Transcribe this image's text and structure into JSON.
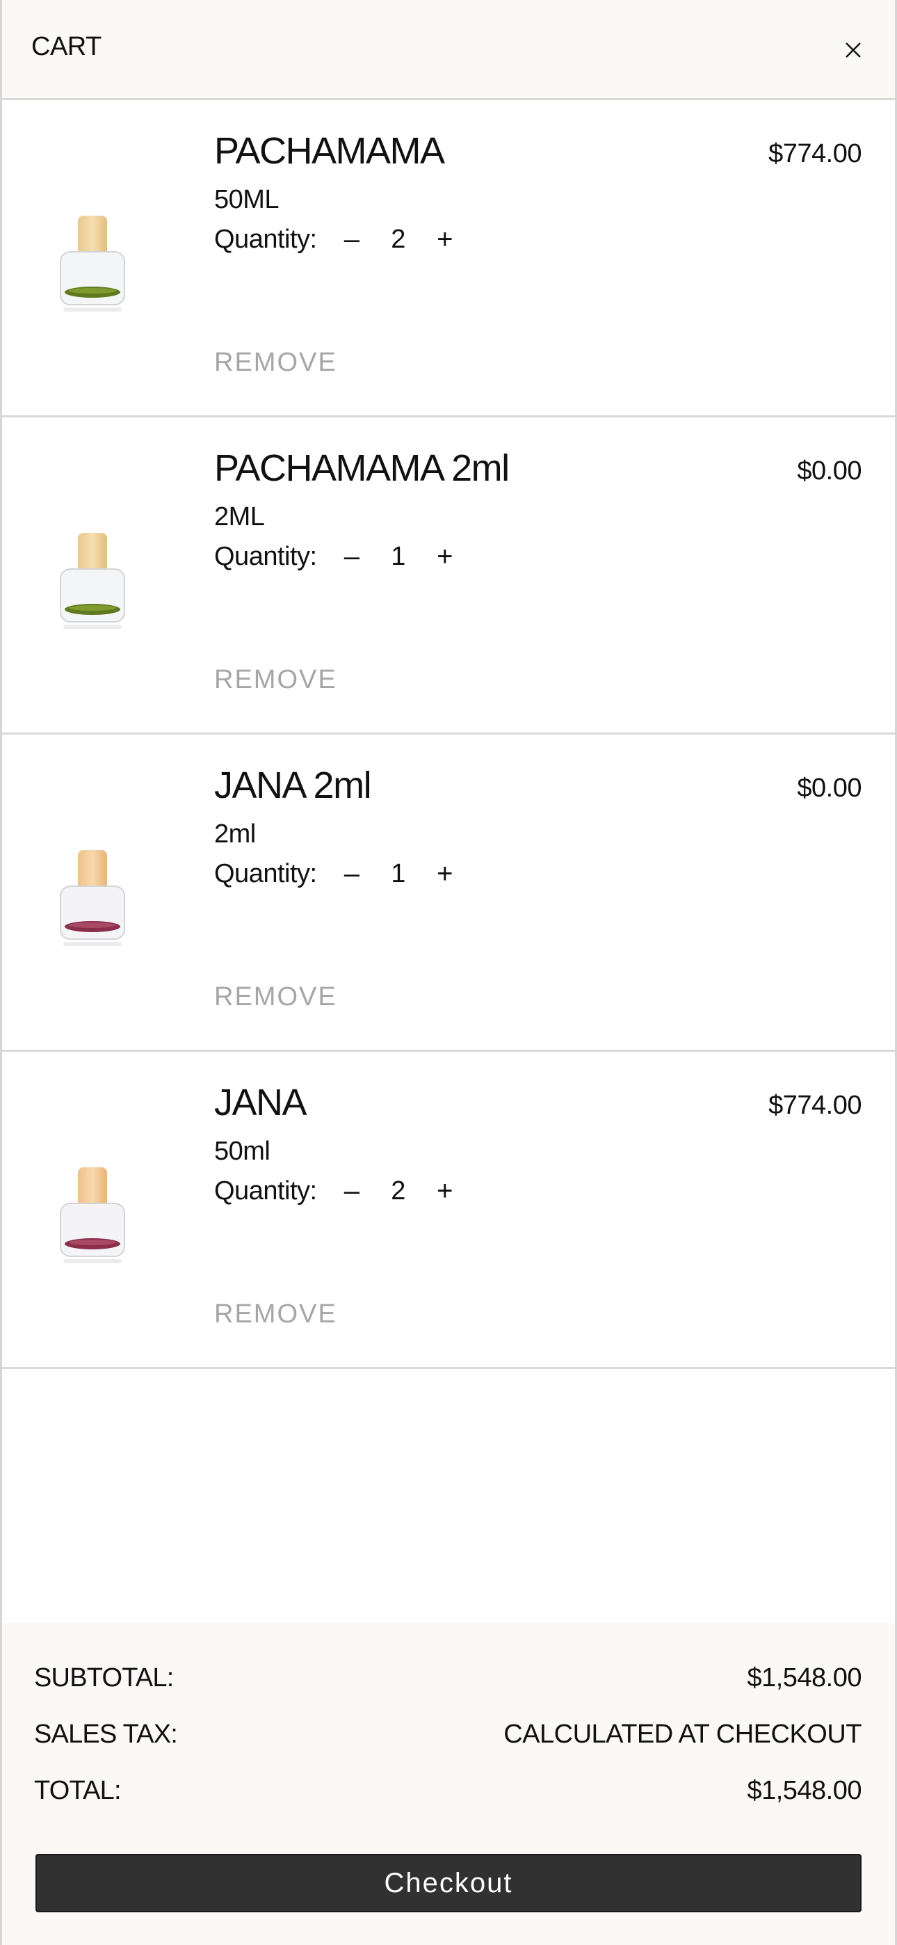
{
  "header": {
    "title": "CART",
    "close_icon": "close-icon"
  },
  "colors": {
    "header_bg": "#faf9f6",
    "remove_text": "#a6a6a6",
    "checkout_bg": "#313131",
    "divider": "#d9d9d9"
  },
  "quantity_label": "Quantity:",
  "decrement_label": "–",
  "increment_label": "+",
  "remove_label": "REMOVE",
  "items": [
    {
      "name": "PACHAMAMA",
      "price": "$774.00",
      "variant": "50ML",
      "quantity": "2",
      "image": "perfume-bottle-green-icon"
    },
    {
      "name": "PACHAMAMA 2ml",
      "price": "$0.00",
      "variant": "2ML",
      "quantity": "1",
      "image": "perfume-bottle-green-icon"
    },
    {
      "name": "JANA 2ml",
      "price": "$0.00",
      "variant": "2ml",
      "quantity": "1",
      "image": "perfume-bottle-red-icon"
    },
    {
      "name": "JANA",
      "price": "$774.00",
      "variant": "50ml",
      "quantity": "2",
      "image": "perfume-bottle-red-icon"
    }
  ],
  "summary": {
    "subtotal_label": "SUBTOTAL:",
    "subtotal_value": "$1,548.00",
    "tax_label": "SALES TAX:",
    "tax_value": "CALCULATED AT CHECKOUT",
    "total_label": "TOTAL:",
    "total_value": "$1,548.00"
  },
  "checkout_label": "Checkout"
}
